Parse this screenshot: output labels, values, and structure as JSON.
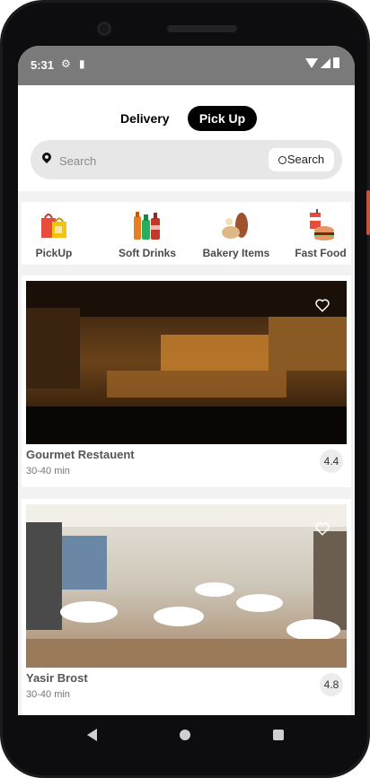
{
  "status_bar": {
    "time": "5:31"
  },
  "tabs": {
    "delivery": "Delivery",
    "pickup": "Pick Up",
    "active": "pickup"
  },
  "search": {
    "placeholder": "Search",
    "button_label": "Search"
  },
  "categories": [
    {
      "label": "PickUp",
      "icon": "shopping-bags-icon"
    },
    {
      "label": "Soft Drinks",
      "icon": "soft-drinks-icon"
    },
    {
      "label": "Bakery Items",
      "icon": "bakery-icon"
    },
    {
      "label": "Fast Food",
      "icon": "fast-food-icon"
    }
  ],
  "restaurants": [
    {
      "name": "Gourmet Restauent",
      "delivery_time": "30-40 min",
      "rating": "4.4"
    },
    {
      "name": "Yasir Brost",
      "delivery_time": "30-40 min",
      "rating": "4.8"
    }
  ],
  "colors": {
    "accent": "#000000",
    "status_bar": "#7a7a7a",
    "background": "#f2f2f2"
  }
}
